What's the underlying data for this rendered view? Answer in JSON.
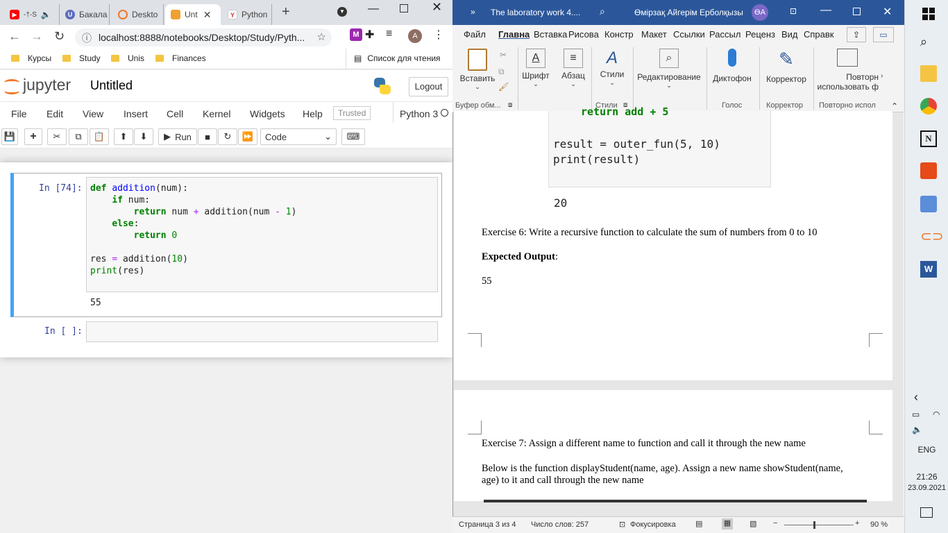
{
  "chrome": {
    "tabs": [
      "Бакала",
      "Deskto",
      "Unt",
      "Python"
    ],
    "tab_yt_badge": "-†-S",
    "address": "localhost:8888/notebooks/Desktop/Study/Pyth...",
    "address_host": "localhost",
    "profile_initial": "A",
    "bookmarks": [
      "Курсы",
      "Study",
      "Unis",
      "Finances"
    ],
    "reading_list": "Список для чтения"
  },
  "jupyter": {
    "logo_text": "jupyter",
    "notebook_name": "Untitled",
    "logout_label": "Logout",
    "menu": [
      "File",
      "Edit",
      "View",
      "Insert",
      "Cell",
      "Kernel",
      "Widgets",
      "Help"
    ],
    "trusted": "Trusted",
    "kernel": "Python 3",
    "run_label": "Run",
    "cell_type": "Code",
    "cell1_prompt": "In [74]:",
    "cell1_output": "55",
    "cell2_prompt": "In [ ]:"
  },
  "word": {
    "title": "The laboratory work 4....",
    "user": "Өмірзақ Айгерім Ерболқызы",
    "user_initials": "ӨА",
    "tabs": [
      "Файл",
      "Главна",
      "Вставка",
      "Рисова",
      "Констр",
      "Макет",
      "Ссылки",
      "Рассыл",
      "Реценз",
      "Вид",
      "Справк"
    ],
    "ribbon": {
      "paste": "Вставить",
      "font": "Шрифт",
      "paragraph": "Абзац",
      "styles": "Стили",
      "editing": "Редактирование",
      "dictate": "Диктофон",
      "editor": "Корректор",
      "reuse": "Повторно использовать ф",
      "reuse_line1": "Повторн",
      "reuse_line2": "использовать ф",
      "group_clipboard": "Буфер обм...",
      "group_styles": "Стили",
      "group_voice": "Голос",
      "group_editor": "Корректор",
      "group_reuse": "Повторно испол"
    },
    "code_partial": "return add + 5",
    "code_line1": "result = outer_fun(5, 10)",
    "code_line2": "print(result)",
    "output1": "20",
    "ex6": "Exercise 6: Write a recursive function to calculate the sum of numbers from 0 to 10",
    "expected_bold": "Expected Output",
    "expected_colon": ":",
    "output2": "55",
    "ex7": "Exercise 7: Assign a different name to function and call it through the new name",
    "ex7_desc1": "Below is the function displayStudent(name, age). Assign a new name showStudent(name,",
    "ex7_desc2": "age) to it and call through the new name",
    "status_page": "Страница 3 из 4",
    "status_words": "Число слов: 257",
    "status_focus": "Фокусировка",
    "zoom": "90 %"
  },
  "taskbar": {
    "lang": "ENG",
    "time": "21:26",
    "date": "23.09.2021"
  }
}
